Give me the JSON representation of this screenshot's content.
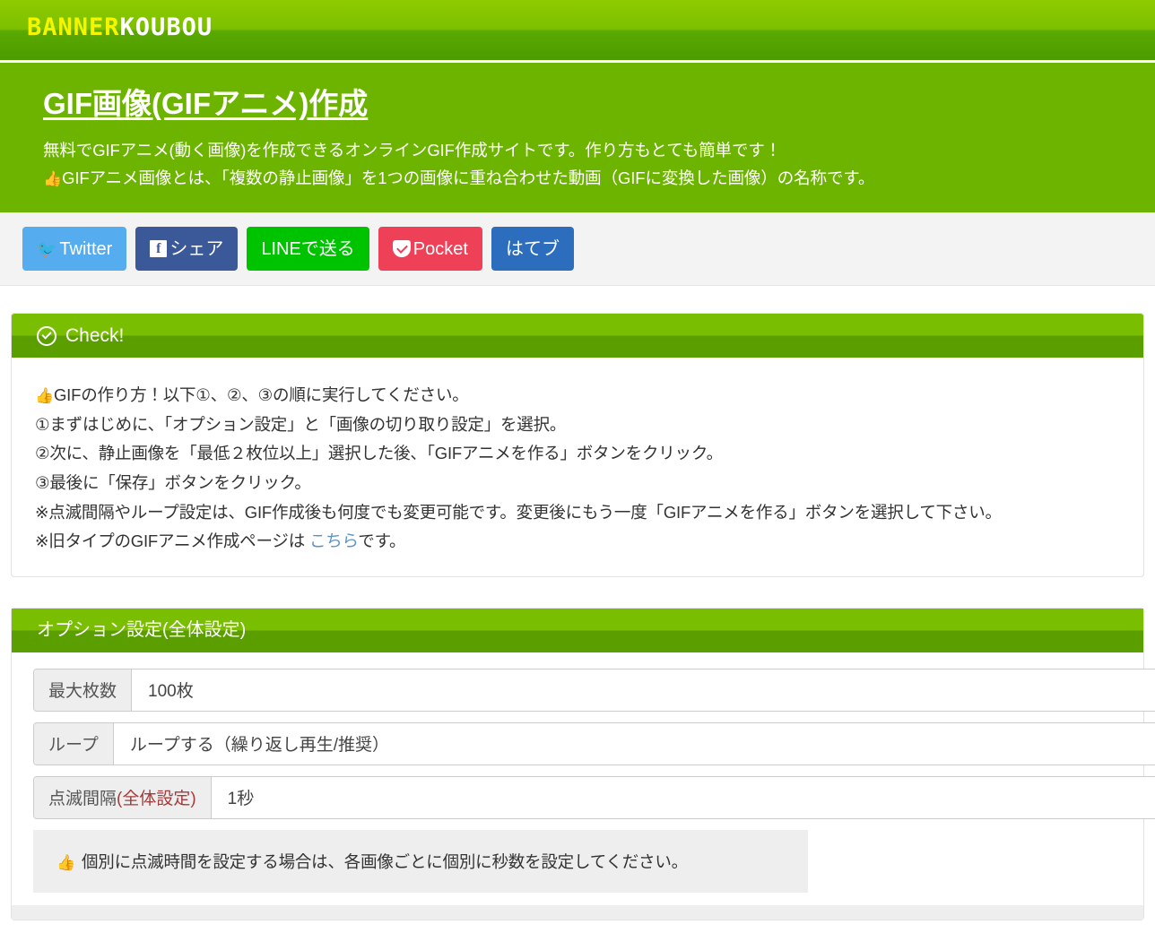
{
  "site": {
    "logo_part1": "BANNER",
    "logo_part2": "KOUBOU",
    "logo_color_primary": "#f5f500",
    "logo_color_secondary": "#ffffff"
  },
  "hero": {
    "title": "GIF画像(GIFアニメ)作成",
    "line1": "無料でGIFアニメ(動く画像)を作成できるオンラインGIF作成サイトです。作り方もとても簡単です！",
    "line2_icon": "thumbs-up-icon",
    "line2": "GIFアニメ画像とは、「複数の静止画像」を1つの画像に重ね合わせた動画（GIFに変換した画像）の名称です。",
    "background_color": "#6cb400"
  },
  "social": {
    "buttons": [
      {
        "name": "twitter",
        "label": "Twitter",
        "icon": "twitter-bird-icon",
        "color": "#55acee"
      },
      {
        "name": "facebook",
        "label": "シェア",
        "icon": "facebook-f-icon",
        "color": "#3b5998"
      },
      {
        "name": "line",
        "label": "LINEで送る",
        "icon": "",
        "color": "#00c300"
      },
      {
        "name": "pocket",
        "label": "Pocket",
        "icon": "pocket-icon",
        "color": "#ee4056"
      },
      {
        "name": "hatena",
        "label": "はてブ",
        "icon": "",
        "color": "#2c6ebd"
      }
    ]
  },
  "check_panel": {
    "header_icon": "check-circle-icon",
    "header_label": "Check!",
    "lines": [
      {
        "icon": "thumbs-up-icon",
        "text": "GIFの作り方！以下①、②、③の順に実行してください。"
      },
      {
        "icon": "",
        "text": "①まずはじめに、「オプション設定」と「画像の切り取り設定」を選択。"
      },
      {
        "icon": "",
        "text": "②次に、静止画像を「最低２枚位以上」選択した後、「GIFアニメを作る」ボタンをクリック。"
      },
      {
        "icon": "",
        "text": "③最後に「保存」ボタンをクリック。"
      },
      {
        "icon": "",
        "text": "※点滅間隔やループ設定は、GIF作成後も何度でも変更可能です。変更後にもう一度「GIFアニメを作る」ボタンを選択して下さい。"
      }
    ],
    "last_line_prefix": "※旧タイプのGIFアニメ作成ページは ",
    "last_line_link": "こちら",
    "last_line_suffix": "です。"
  },
  "options": {
    "header_label": "オプション設定(全体設定)",
    "rows": [
      {
        "label": "最大枚数",
        "label_red": "",
        "value": "100枚"
      },
      {
        "label": "ループ",
        "label_red": "",
        "value": "ループする（繰り返し再生/推奨）"
      },
      {
        "label": "点滅間隔",
        "label_red": "(全体設定)",
        "value": "1秒"
      }
    ],
    "note_icon": "thumbs-up-icon",
    "note": "個別に点滅時間を設定する場合は、各画像ごとに個別に秒数を設定してください。"
  }
}
